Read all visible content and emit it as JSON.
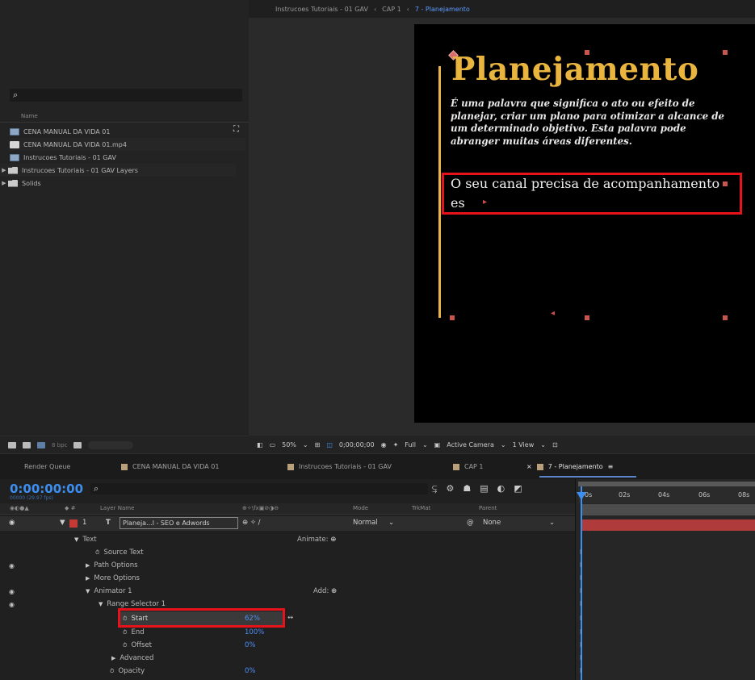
{
  "project": {
    "search_icon": "search-icon",
    "name_header": "Name",
    "items": [
      {
        "label": "CENA MANUAL DA VIDA 01",
        "icon": "composition-icon"
      },
      {
        "label": "CENA MANUAL DA VIDA 01.mp4",
        "icon": "file-icon"
      },
      {
        "label": "Instrucoes Tutoriais - 01 GAV",
        "icon": "composition-icon"
      },
      {
        "label": "Instrucoes Tutoriais - 01 GAV Layers",
        "icon": "folder-icon"
      },
      {
        "label": "Solids",
        "icon": "folder-icon"
      }
    ],
    "bpc": "8 bpc"
  },
  "viewer": {
    "breadcrumb": [
      "Instrucoes Tutoriais - 01 GAV",
      "CAP 1",
      "7 - Planejamento"
    ],
    "canvas": {
      "title": "Planejamento",
      "description": "É uma palavra que significa o ato ou efeito de planejar, criar um plano para otimizar a alcance de um determinado objetivo. Esta palavra pode abranger muitas áreas diferentes.",
      "typed_line1": "O seu canal precisa de acompanhamento",
      "typed_line2": "es"
    },
    "toolbar": {
      "zoom": "50%",
      "timecode": "0;00;00;00",
      "resolution": "Full",
      "camera": "Active Camera",
      "views": "1 View"
    }
  },
  "timeline": {
    "tabs": [
      "Render Queue",
      "CENA MANUAL DA VIDA 01",
      "Instrucoes Tutoriais - 01 GAV",
      "CAP 1",
      "7 - Planejamento"
    ],
    "timecode": "0:00:00:00",
    "fps": "00000 (29.97 fps)",
    "columns": {
      "layer_name": "Layer Name",
      "mode": "Mode",
      "trkmat": "TrkMat",
      "parent": "Parent"
    },
    "layer": {
      "number": "1",
      "type": "T",
      "name": "Planeja...l  - SEO e Adwords",
      "mode": "Normal",
      "parent": "None"
    },
    "props": {
      "text": "Text",
      "animate": "Animate:",
      "source_text": "Source Text",
      "path_options": "Path Options",
      "more_options": "More Options",
      "animator": "Animator 1",
      "add": "Add:",
      "range_selector": "Range Selector 1",
      "start": "Start",
      "start_value": "62%",
      "end": "End",
      "end_value": "100%",
      "offset": "Offset",
      "offset_value": "0%",
      "advanced": "Advanced",
      "opacity": "Opacity",
      "opacity_value": "0%"
    },
    "ruler": [
      "0s",
      "02s",
      "04s",
      "06s",
      "08s"
    ]
  },
  "colors": {
    "accent": "#3c8ff0",
    "title": "#e9b53f",
    "highlight": "#e8131a",
    "layer_bar": "#b03b3b"
  }
}
